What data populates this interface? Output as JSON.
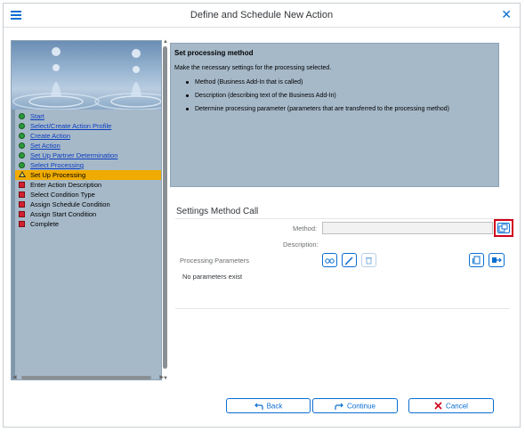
{
  "window": {
    "title": "Define and Schedule New Action",
    "menu_icon": "hamburger-menu-icon",
    "close_icon": "close-icon"
  },
  "steps": [
    {
      "label": "Start",
      "status": "done",
      "link": true
    },
    {
      "label": "Select/Create Action Profile",
      "status": "done",
      "link": true
    },
    {
      "label": "Create Action",
      "status": "done",
      "link": true
    },
    {
      "label": "Set Action",
      "status": "done",
      "link": true
    },
    {
      "label": "Set Up Partner Determination",
      "status": "done",
      "link": true
    },
    {
      "label": "Select Processing",
      "status": "done",
      "link": true
    },
    {
      "label": "Set Up Processing",
      "status": "current",
      "link": false
    },
    {
      "label": "Enter Action Description",
      "status": "open",
      "link": false
    },
    {
      "label": "Select Condition Type",
      "status": "open",
      "link": false
    },
    {
      "label": "Assign Schedule Condition",
      "status": "open",
      "link": false
    },
    {
      "label": "Assign Start Condition",
      "status": "open",
      "link": false
    },
    {
      "label": "Complete",
      "status": "open",
      "link": false
    }
  ],
  "info": {
    "title": "Set processing method",
    "intro": "Make the necessary settings for the processing selected.",
    "bullets": [
      "Method (Business Add-In that is called)",
      "Description (describing text of the Business Add-In)",
      "Determine processing parameter (parameters that are transferred to the processing method)"
    ]
  },
  "settings": {
    "title": "Settings Method Call",
    "method_label": "Method:",
    "method_value": "",
    "description_label": "Description:",
    "params_label": "Processing Parameters",
    "no_params": "No parameters exist"
  },
  "footer": {
    "back": "Back",
    "continue": "Continue",
    "cancel": "Cancel"
  },
  "colors": {
    "accent": "#0a6ed1",
    "panel": "#a6b9c9",
    "current_step": "#f0ab00",
    "cancel_red": "#d0021b"
  }
}
